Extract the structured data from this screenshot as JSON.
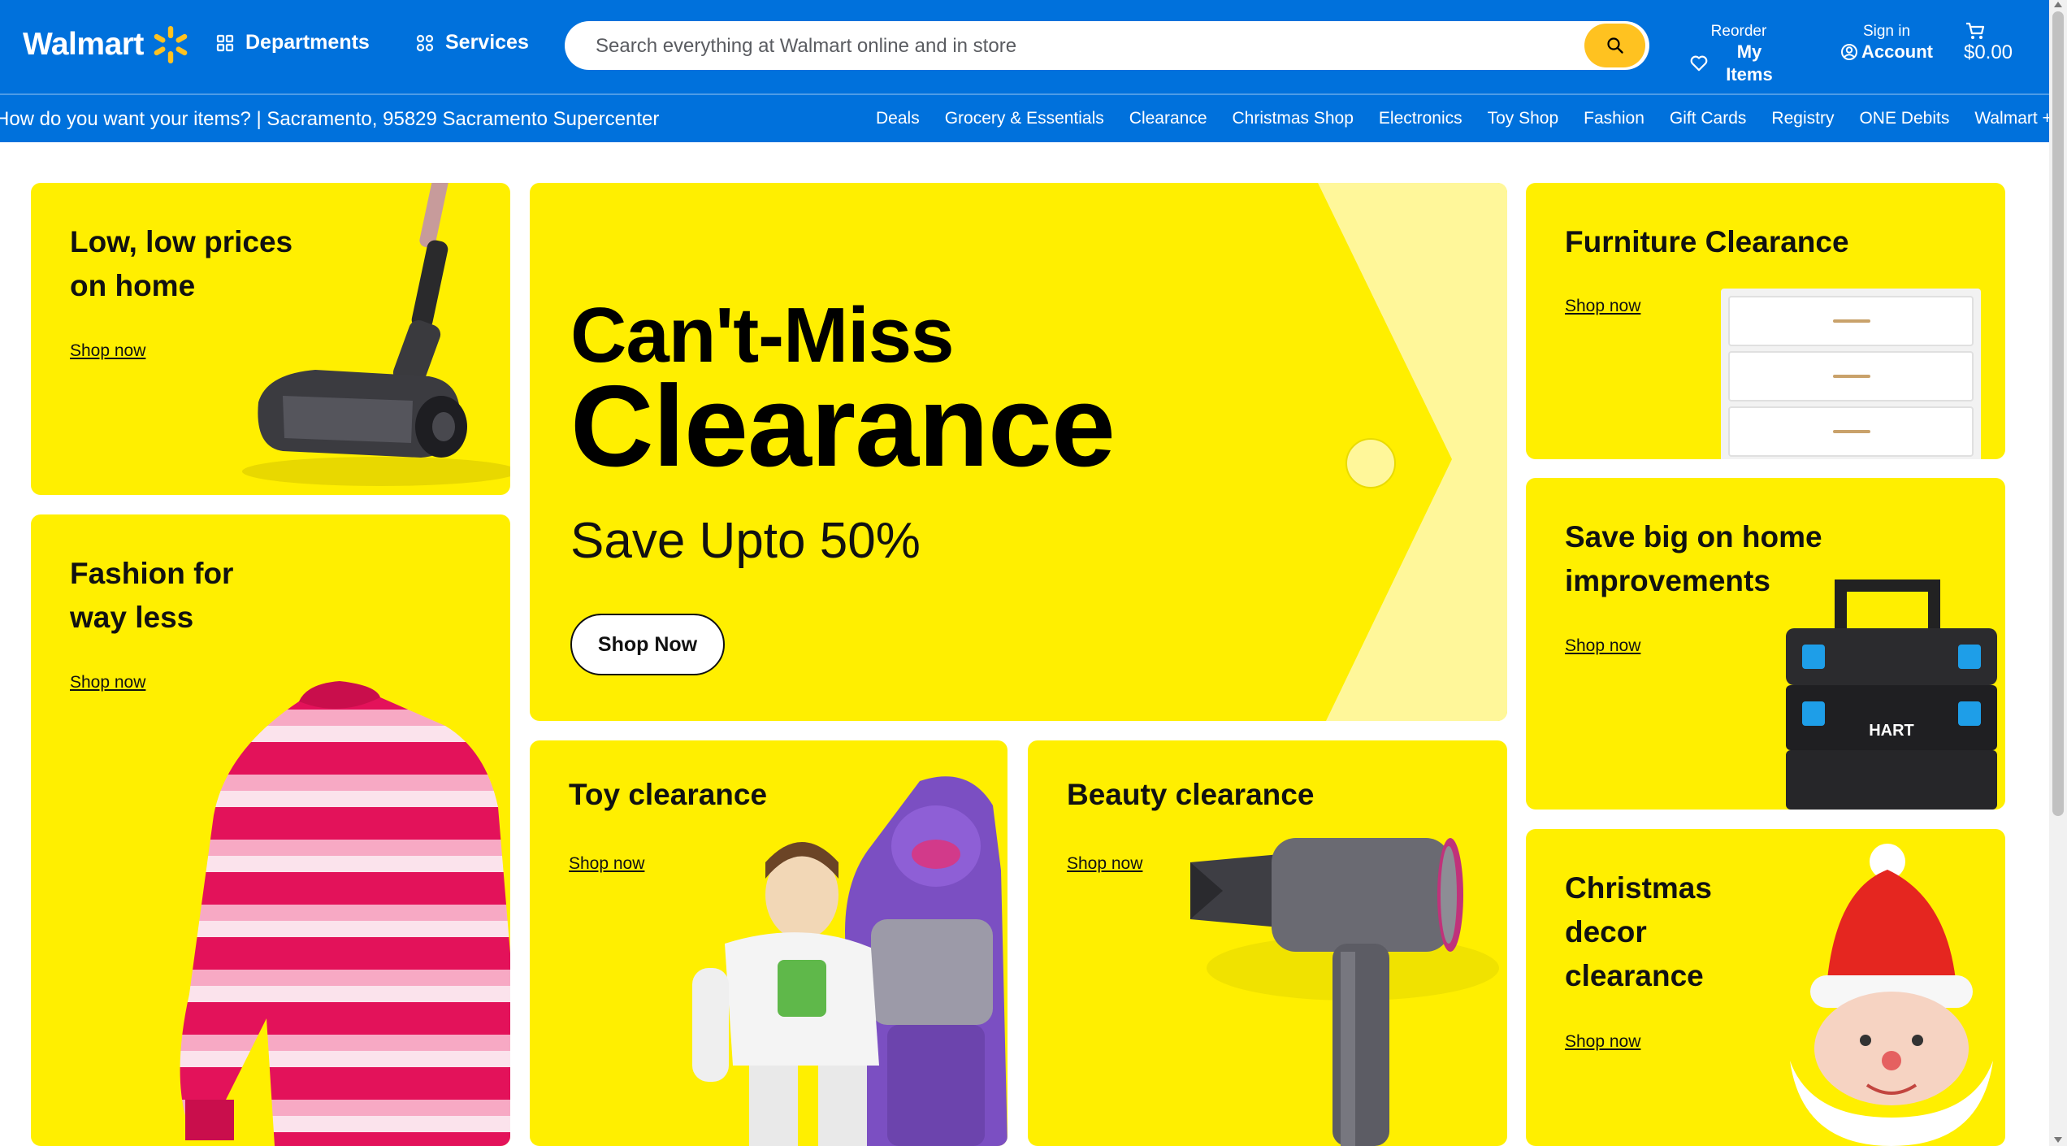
{
  "header": {
    "logo_text": "Walmart",
    "departments_label": "Departments",
    "services_label": "Services",
    "search_placeholder": "Search everything at Walmart online and in store",
    "reorder_top": "Reorder",
    "reorder_label": "My Items",
    "signin_top": "Sign in",
    "account_label": "Account",
    "cart_total": "$0.00"
  },
  "nav": {
    "store_text": "How do you want your items? | Sacramento, 95829 Sacramento Supercenter",
    "items": [
      "Deals",
      "Grocery & Essentials",
      "Clearance",
      "Christmas Shop",
      "Electronics",
      "Toy Shop",
      "Fashion",
      "Gift Cards",
      "Registry",
      "ONE Debits",
      "Walmart +"
    ]
  },
  "cards": {
    "home": {
      "title_1": "Low, low prices",
      "title_2": "on home",
      "link": "Shop now"
    },
    "fashion": {
      "title_1": "Fashion for",
      "title_2": "way less",
      "link": "Shop now"
    },
    "hero": {
      "line_1": "Can't-Miss",
      "line_2": "Clearance",
      "subtitle": "Save Upto 50%",
      "button": "Shop Now"
    },
    "toy": {
      "title": "Toy clearance",
      "link": "Shop now"
    },
    "beauty": {
      "title": "Beauty clearance",
      "link": "Shop now"
    },
    "furniture": {
      "title": "Furniture Clearance",
      "link": "Shop now"
    },
    "improve": {
      "title_1": "Save big on home",
      "title_2": "improvements",
      "link": "Shop now",
      "toolbox_brand": "HART"
    },
    "christmas": {
      "title_1": "Christmas",
      "title_2": "decor",
      "title_3": "clearance",
      "link": "Shop now"
    }
  },
  "colors": {
    "brand_blue": "#0071dc",
    "spark_yellow": "#ffc220",
    "card_yellow": "#ffef00"
  }
}
